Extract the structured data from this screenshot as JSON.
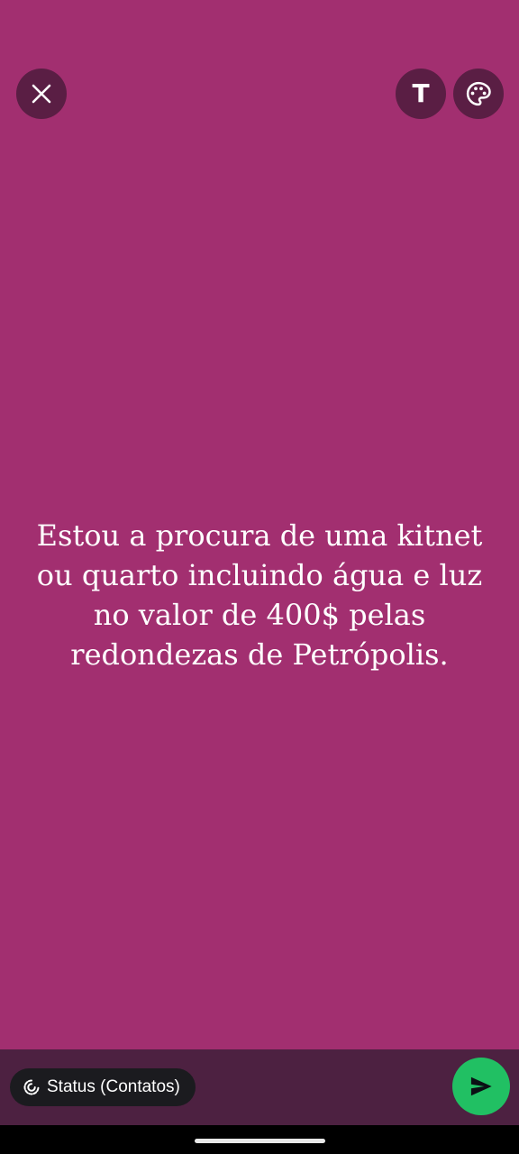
{
  "status_editor": {
    "background_color": "#A22F70",
    "text": "Estou a procura de uma kitnet\nou quarto incluindo água e luz\nno valor de 400$ pelas\nredondezas de Petrópolis.",
    "top_bar": {
      "close_icon": "close-icon",
      "font_button_label": "T",
      "palette_icon": "palette-icon"
    }
  },
  "bottom_bar": {
    "audience_label": "Status (Contatos)",
    "audience_icon": "status-ring-icon",
    "send_icon": "send-icon",
    "send_color": "#21C063"
  }
}
